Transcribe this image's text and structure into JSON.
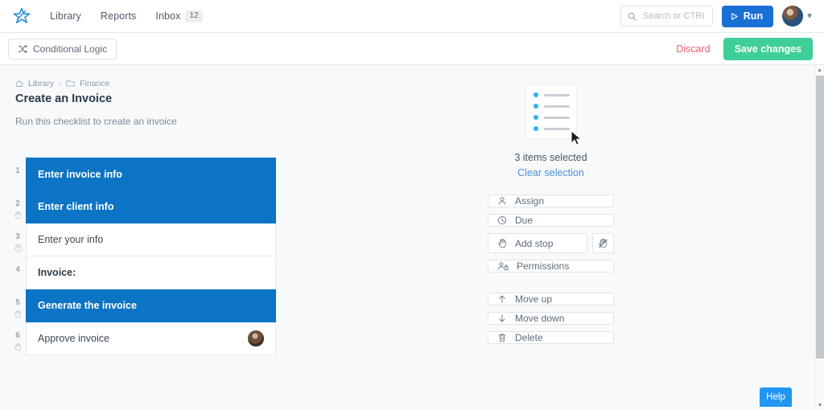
{
  "topnav": {
    "logo_icon": "star-logo-icon",
    "links": [
      {
        "label": "Library",
        "name": "nav-link-library"
      },
      {
        "label": "Reports",
        "name": "nav-link-reports"
      }
    ],
    "inbox": {
      "label": "Inbox",
      "badge": "12"
    },
    "search": {
      "placeholder": "Search or CTRL+K",
      "value": "",
      "icon": "search-icon"
    },
    "run_button": {
      "label": "Run",
      "icon": "play-icon"
    },
    "avatar_icon": "user-avatar",
    "chevron_icon": "chevron-down-icon"
  },
  "toolbar": {
    "conditional_logic": {
      "label": "Conditional Logic",
      "icon": "shuffle-icon"
    },
    "discard_label": "Discard",
    "save_label": "Save changes"
  },
  "breadcrumb": {
    "home_icon": "home-icon",
    "items": [
      {
        "label": "Library"
      },
      {
        "label": "Finance",
        "icon": "folder-icon"
      }
    ],
    "separator": "›"
  },
  "page": {
    "title": "Create an Invoice",
    "subtitle": "Run this checklist to create an invoice"
  },
  "tasks": [
    {
      "number": "1",
      "label": "Enter invoice info",
      "selected": true,
      "stop": false,
      "bold": false,
      "avatar": false
    },
    {
      "number": "2",
      "label": "Enter client info",
      "selected": true,
      "stop": true,
      "bold": false,
      "avatar": false
    },
    {
      "number": "3",
      "label": "Enter your info",
      "selected": false,
      "stop": true,
      "bold": false,
      "avatar": false
    },
    {
      "number": "4",
      "label": "Invoice:",
      "selected": false,
      "stop": false,
      "bold": true,
      "avatar": false
    },
    {
      "number": "5",
      "label": "Generate the invoice",
      "selected": true,
      "stop": true,
      "bold": false,
      "avatar": false
    },
    {
      "number": "6",
      "label": "Approve invoice",
      "selected": false,
      "stop": true,
      "bold": false,
      "avatar": true
    }
  ],
  "panel": {
    "illustration": {
      "name": "checklist-selection-illustration",
      "dots": 4,
      "cursor_icon": "cursor-arrow-icon"
    },
    "selected_text": "3 items selected",
    "clear_label": "Clear selection",
    "actions_primary": [
      {
        "label": "Assign",
        "icon": "person-icon",
        "name": "assign-button"
      },
      {
        "label": "Due",
        "icon": "clock-icon",
        "name": "due-button"
      },
      {
        "label": "Add stop",
        "icon": "hand-stop-icon",
        "name": "add-stop-button"
      },
      {
        "label": "Permissions",
        "icon": "person-lock-icon",
        "name": "permissions-button"
      }
    ],
    "remove_stop": {
      "icon": "hand-stop-slash-icon",
      "name": "remove-stop-button"
    },
    "actions_secondary": [
      {
        "label": "Move up",
        "icon": "arrow-up-icon",
        "name": "move-up-button"
      },
      {
        "label": "Move down",
        "icon": "arrow-down-icon",
        "name": "move-down-button"
      },
      {
        "label": "Delete",
        "icon": "trash-icon",
        "name": "delete-button"
      }
    ]
  },
  "help": {
    "label": "Help"
  },
  "colors": {
    "accent_blue": "#1a6fd4",
    "selected_blue": "#0c74c4",
    "save_green": "#3fce98",
    "discard_red": "#ef5f73",
    "link_blue": "#4a90d9",
    "dot_cyan": "#25b4ec",
    "help_blue": "#2196f3"
  }
}
